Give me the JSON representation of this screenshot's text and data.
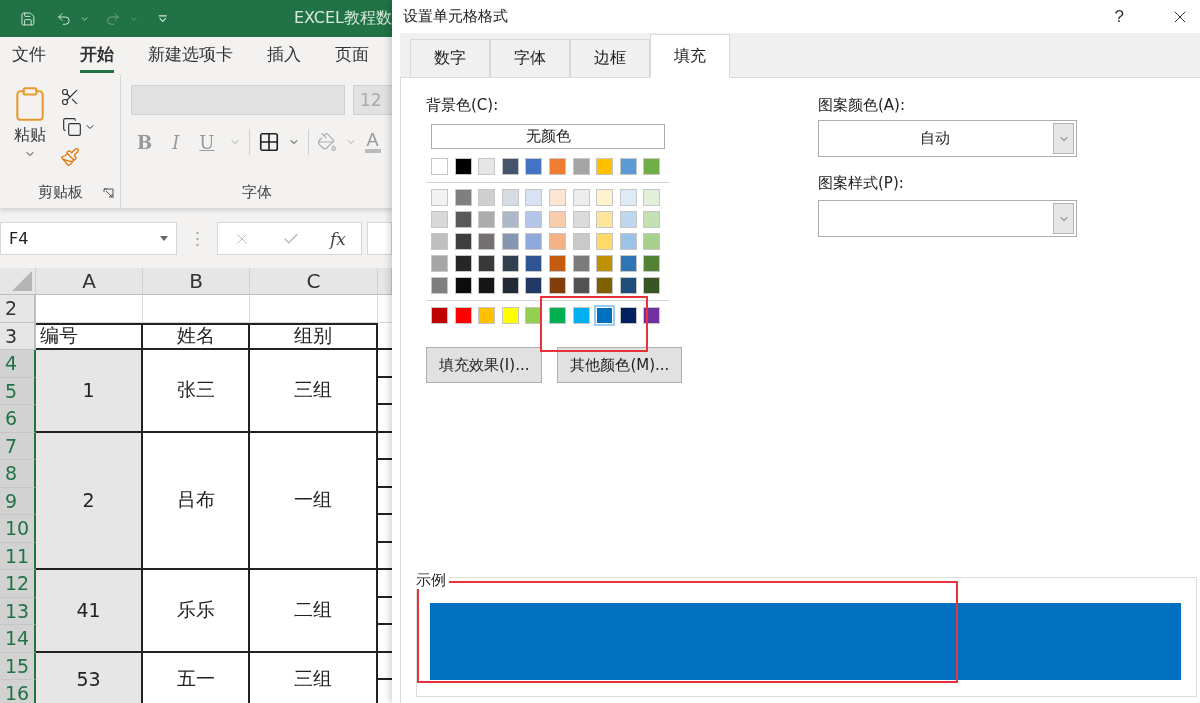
{
  "excel": {
    "title": "EXCEL教程数",
    "ribbon_tabs": [
      {
        "label": "文件",
        "selected": false
      },
      {
        "label": "开始",
        "selected": true
      },
      {
        "label": "新建选项卡",
        "selected": false
      },
      {
        "label": "插入",
        "selected": false
      },
      {
        "label": "页面",
        "selected": false
      }
    ],
    "clipboard": {
      "paste_label": "粘贴",
      "group_label": "剪贴板"
    },
    "font": {
      "size": "12",
      "bold": "B",
      "italic": "I",
      "underline": "U",
      "font_color": "A",
      "group_label": "字体"
    },
    "formula_bar": {
      "name_box": "F4",
      "fx": "fx"
    },
    "sheet": {
      "columns": [
        "A",
        "B",
        "C"
      ],
      "rows": [
        {
          "kind": "empty",
          "headers": [
            {
              "label": "2",
              "selected": false
            }
          ]
        },
        {
          "kind": "header",
          "headers": [
            {
              "label": "3",
              "selected": false
            }
          ],
          "cells": [
            "编号",
            "姓名",
            "组别"
          ]
        },
        {
          "kind": "data",
          "headers": [
            {
              "label": "4",
              "selected": true
            },
            {
              "label": "5",
              "selected": true
            },
            {
              "label": "6",
              "selected": true
            }
          ],
          "cells": [
            "1",
            "张三",
            "三组"
          ]
        },
        {
          "kind": "data",
          "headers": [
            {
              "label": "7",
              "selected": true
            },
            {
              "label": "8",
              "selected": true
            },
            {
              "label": "9",
              "selected": true
            },
            {
              "label": "10",
              "selected": true
            },
            {
              "label": "11",
              "selected": true
            }
          ],
          "cells": [
            "2",
            "吕布",
            "一组"
          ]
        },
        {
          "kind": "data",
          "headers": [
            {
              "label": "12",
              "selected": true
            },
            {
              "label": "13",
              "selected": true
            },
            {
              "label": "14",
              "selected": true
            }
          ],
          "cells": [
            "41",
            "乐乐",
            "二组"
          ]
        },
        {
          "kind": "data",
          "headers": [
            {
              "label": "15",
              "selected": true
            },
            {
              "label": "16",
              "selected": true
            }
          ],
          "cells": [
            "53",
            "五一",
            "三组"
          ]
        }
      ]
    }
  },
  "dialog": {
    "title": "设置单元格格式",
    "help": "?",
    "tabs": [
      {
        "label": "数字",
        "selected": false
      },
      {
        "label": "字体",
        "selected": false
      },
      {
        "label": "边框",
        "selected": false
      },
      {
        "label": "填充",
        "selected": true
      }
    ],
    "fill": {
      "background_label": "背景色(C):",
      "no_color": "无颜色",
      "theme_colors": [
        {
          "color": "#ffffff",
          "selected": false
        },
        {
          "color": "#000000",
          "selected": false
        },
        {
          "color": "#e7e6e6",
          "selected": false
        },
        {
          "color": "#44546a",
          "selected": false
        },
        {
          "color": "#4472c4",
          "selected": false
        },
        {
          "color": "#ed7d31",
          "selected": false
        },
        {
          "color": "#a5a5a5",
          "selected": false
        },
        {
          "color": "#ffc000",
          "selected": false
        },
        {
          "color": "#5b9bd5",
          "selected": false
        },
        {
          "color": "#70ad47",
          "selected": false
        }
      ],
      "shade_rows": [
        [
          {
            "color": "#f2f2f2",
            "selected": false
          },
          {
            "color": "#7f7f7f",
            "selected": false
          },
          {
            "color": "#d0cece",
            "selected": false
          },
          {
            "color": "#d6dce4",
            "selected": false
          },
          {
            "color": "#d9e2f3",
            "selected": false
          },
          {
            "color": "#fbe5d5",
            "selected": false
          },
          {
            "color": "#ededed",
            "selected": false
          },
          {
            "color": "#fff2cc",
            "selected": false
          },
          {
            "color": "#deebf6",
            "selected": false
          },
          {
            "color": "#e2efd9",
            "selected": false
          }
        ],
        [
          {
            "color": "#d8d8d8",
            "selected": false
          },
          {
            "color": "#595959",
            "selected": false
          },
          {
            "color": "#aeabab",
            "selected": false
          },
          {
            "color": "#adb9ca",
            "selected": false
          },
          {
            "color": "#b4c6e7",
            "selected": false
          },
          {
            "color": "#f7cbac",
            "selected": false
          },
          {
            "color": "#dbdbdb",
            "selected": false
          },
          {
            "color": "#fee599",
            "selected": false
          },
          {
            "color": "#bdd7ee",
            "selected": false
          },
          {
            "color": "#c5e0b3",
            "selected": false
          }
        ],
        [
          {
            "color": "#bfbfbf",
            "selected": false
          },
          {
            "color": "#3f3f3f",
            "selected": false
          },
          {
            "color": "#757070",
            "selected": false
          },
          {
            "color": "#8496b0",
            "selected": false
          },
          {
            "color": "#8eaadb",
            "selected": false
          },
          {
            "color": "#f4b183",
            "selected": false
          },
          {
            "color": "#c9c9c9",
            "selected": false
          },
          {
            "color": "#ffd965",
            "selected": false
          },
          {
            "color": "#9cc3e5",
            "selected": false
          },
          {
            "color": "#a8d08d",
            "selected": false
          }
        ],
        [
          {
            "color": "#a5a5a5",
            "selected": false
          },
          {
            "color": "#262626",
            "selected": false
          },
          {
            "color": "#3a3838",
            "selected": false
          },
          {
            "color": "#323f4f",
            "selected": false
          },
          {
            "color": "#2f5496",
            "selected": false
          },
          {
            "color": "#c55a11",
            "selected": false
          },
          {
            "color": "#7b7b7b",
            "selected": false
          },
          {
            "color": "#bf9000",
            "selected": false
          },
          {
            "color": "#2e75b5",
            "selected": false
          },
          {
            "color": "#538135",
            "selected": false
          }
        ],
        [
          {
            "color": "#7f7f7f",
            "selected": false
          },
          {
            "color": "#0c0c0c",
            "selected": false
          },
          {
            "color": "#171616",
            "selected": false
          },
          {
            "color": "#222a35",
            "selected": false
          },
          {
            "color": "#1f3864",
            "selected": false
          },
          {
            "color": "#833c0b",
            "selected": false
          },
          {
            "color": "#525252",
            "selected": false
          },
          {
            "color": "#7f6000",
            "selected": false
          },
          {
            "color": "#1e4e79",
            "selected": false
          },
          {
            "color": "#375623",
            "selected": false
          }
        ]
      ],
      "standard_colors": [
        {
          "color": "#c00000",
          "selected": false
        },
        {
          "color": "#ff0000",
          "selected": false
        },
        {
          "color": "#ffc000",
          "selected": false
        },
        {
          "color": "#ffff00",
          "selected": false
        },
        {
          "color": "#92d050",
          "selected": false
        },
        {
          "color": "#00b050",
          "selected": false
        },
        {
          "color": "#00b0f0",
          "selected": false
        },
        {
          "color": "#0070c0",
          "selected": true
        },
        {
          "color": "#002060",
          "selected": false
        },
        {
          "color": "#7030a0",
          "selected": false
        }
      ],
      "buttons": [
        "填充效果(I)...",
        "其他颜色(M)..."
      ],
      "pattern_color_label": "图案颜色(A):",
      "pattern_color": "自动",
      "pattern_style_label": "图案样式(P):",
      "sample_label": "示例"
    }
  }
}
